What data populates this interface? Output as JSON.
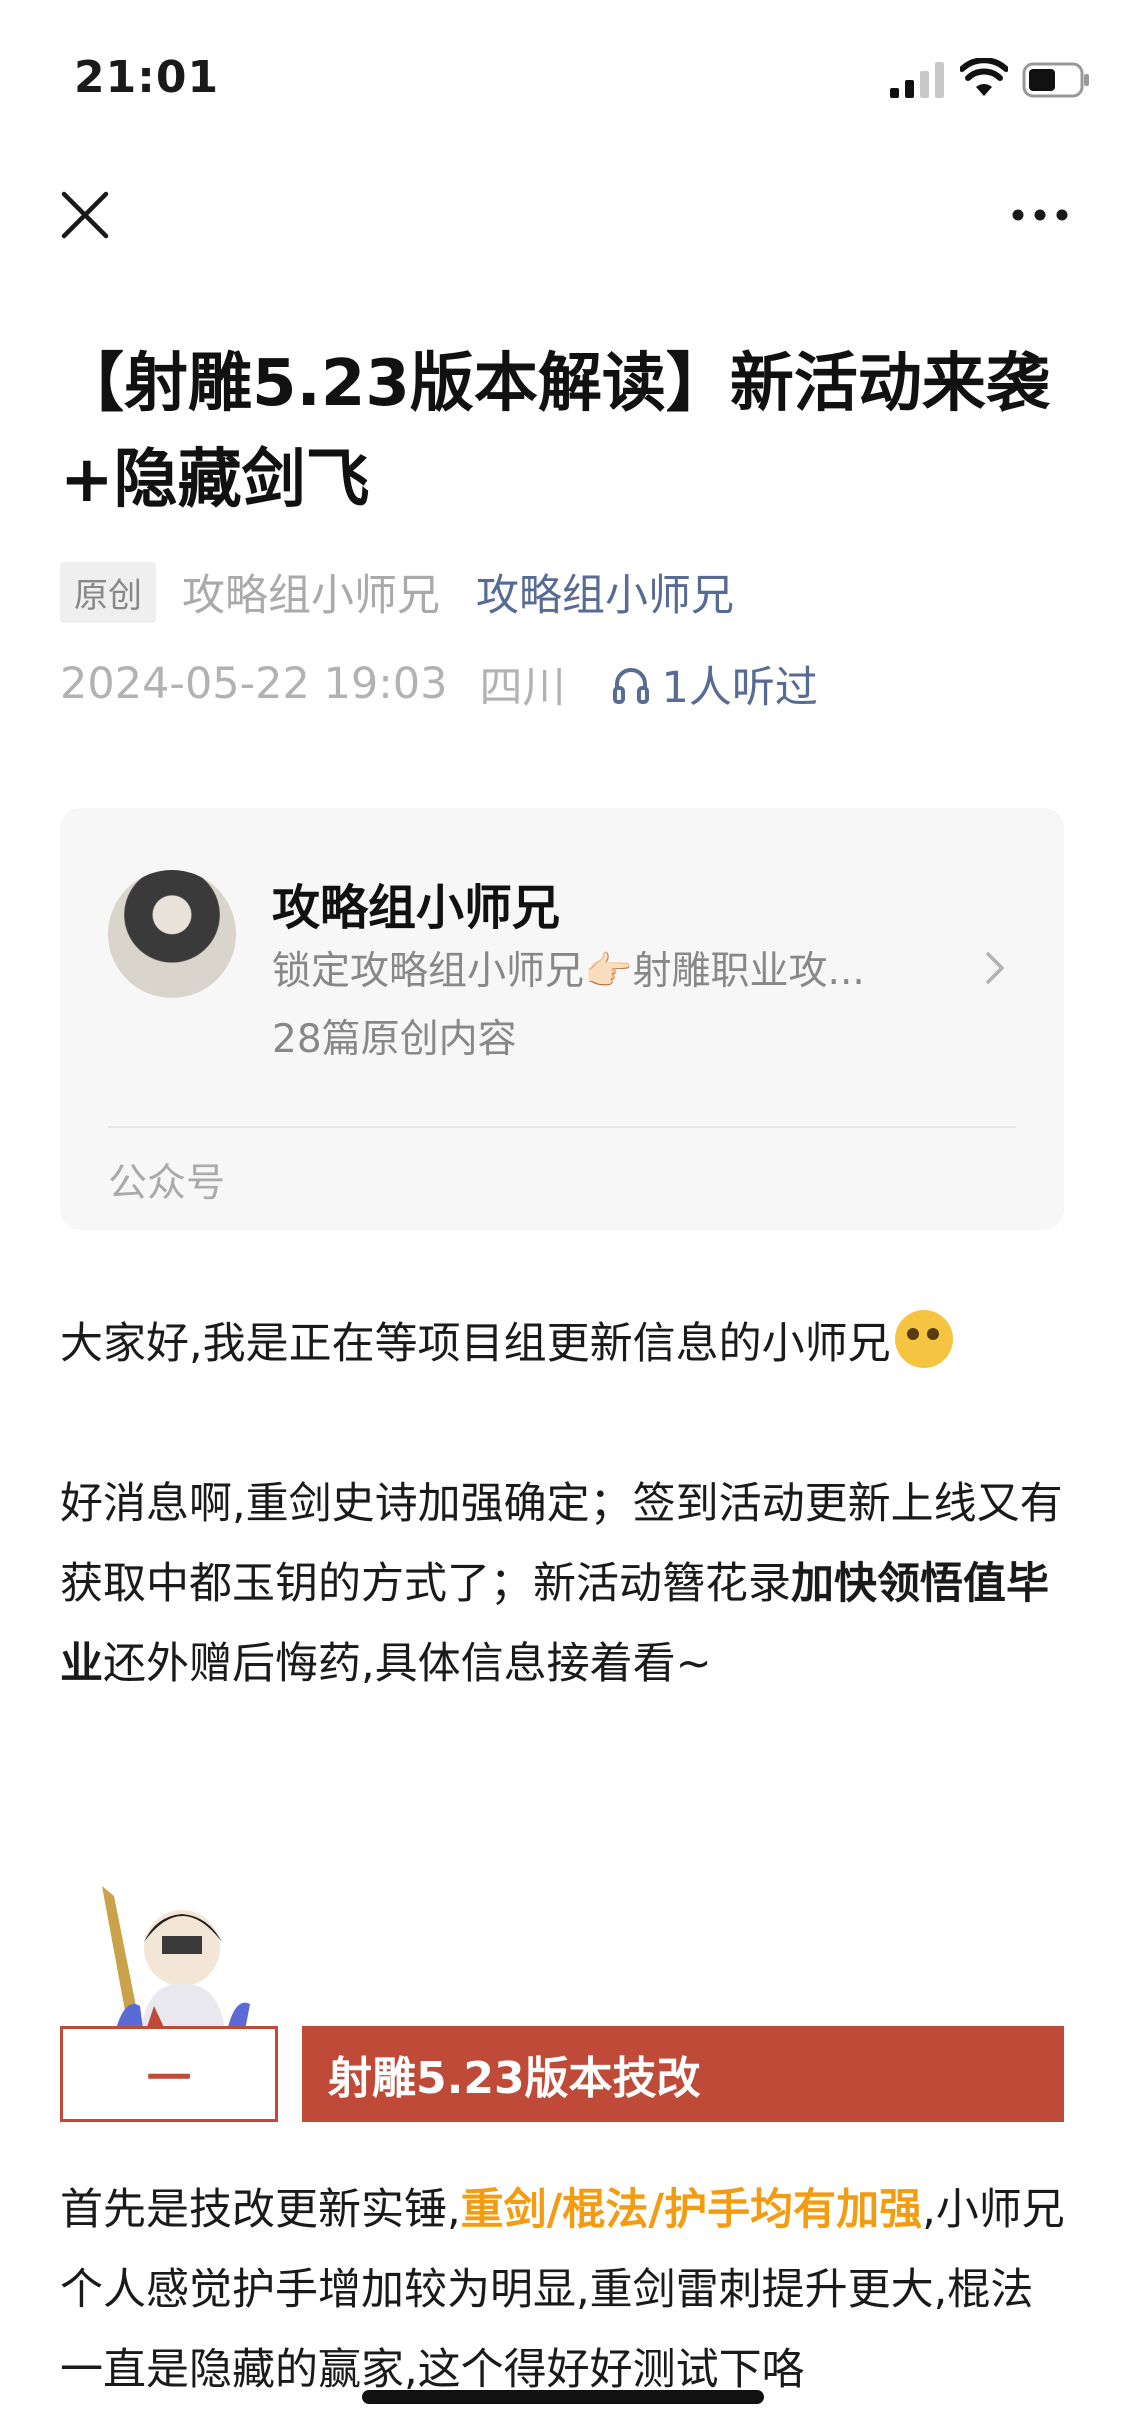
{
  "status_bar": {
    "time": "21:01"
  },
  "nav": {
    "close_icon": "close-icon",
    "more_icon": "more-icon"
  },
  "article": {
    "title": "【射雕5.23版本解读】新活动来袭+隐藏剑飞",
    "original_badge": "原创",
    "author": "攻略组小师兄",
    "account_link": "攻略组小师兄",
    "datetime": "2024-05-22 19:03",
    "location": "四川",
    "listen_count": "1人听过"
  },
  "profile_card": {
    "name": "攻略组小师兄",
    "desc": "锁定攻略组小师兄👉🏻射雕职业攻...",
    "count": "28篇原创内容",
    "type": "公众号"
  },
  "content": {
    "p1": "大家好,我是正在等项目组更新信息的小师兄",
    "p2_a": "好消息啊,重剑史诗加强确定；签到活动更新上线又有获取中都玉钥的方式了；新活动簪花录",
    "p2_bold": "加快领悟值毕业",
    "p2_b": "还外赠后悔药,具体信息接着看~",
    "section_number": "一",
    "section_title": "射雕5.23版本技改",
    "p3_a": "首先是技改更新实锤,",
    "p3_highlight": "重剑/棍法/护手均有加强",
    "p3_b": ",小师兄个人感觉护手增加较为明显,重剑雷刺提升更大,棍法一直是隐藏的赢家,这个得好好测试下咯"
  },
  "colors": {
    "link": "#576b95",
    "accent_red": "#c04a38",
    "highlight_orange": "#f39c12"
  }
}
